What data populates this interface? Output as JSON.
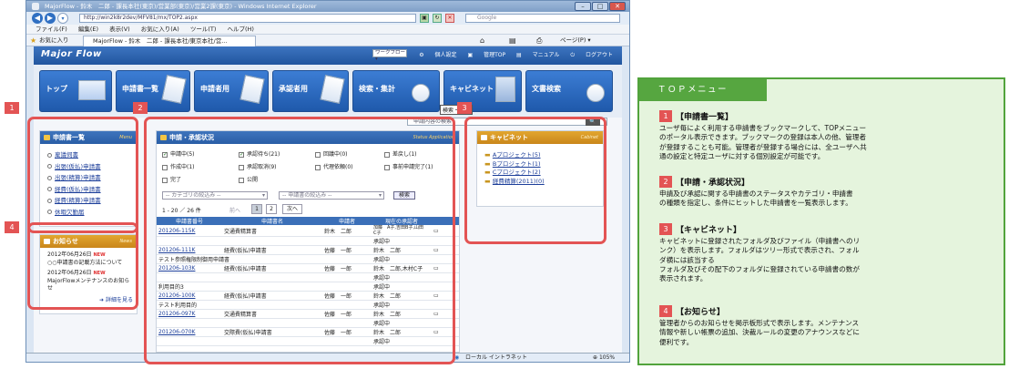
{
  "ie": {
    "title": "MajorFlow - 鈴木　二郎 - 課長本社(東京)/営業部(東京)/営業2課(東京) - Windows Internet Explorer",
    "address": "http://win2k8r2dev/MFV81/mx/TOP2.aspx",
    "search_placeholder": "Google",
    "menu": [
      "ファイル(F)",
      "編集(E)",
      "表示(V)",
      "お気に入り(A)",
      "ツール(T)",
      "ヘルプ(H)"
    ],
    "favorites_label": "お気に入り",
    "tab_label": "MajorFlow - 鈴木　二郎 - 課長本社/東京本社/営...",
    "page_label": "ページ(P) ▾",
    "status_zone": "ローカル イントラネット",
    "zoom": "105%"
  },
  "app": {
    "logo": "Major Flow",
    "header_links": [
      "個人設定",
      "管理TOP",
      "マニュアル",
      "ログアウト"
    ],
    "header_select": "ワークフロー",
    "nav": [
      "トップ",
      "申請書一覧",
      "申請者用",
      "承認者用",
      "検索・集計",
      "キャビネット",
      "文書検索"
    ],
    "tooltip": "検索・集計",
    "search_placeholder": "申請内容の検索"
  },
  "panels": {
    "list": {
      "title": "申請書一覧",
      "sub": "Menu",
      "items": [
        "稟議伺書",
        "出張(仮払)申請書",
        "出張(精算)申請書",
        "経費(仮払)申請書",
        "経費(精算)申請書",
        "休暇欠勤届"
      ]
    },
    "notice": {
      "title": "お知らせ",
      "sub": "News",
      "items": [
        {
          "date": "2012年06月26日",
          "badge": "NEW",
          "text": "○○申請書の記載方法について"
        },
        {
          "date": "2012年06月26日",
          "badge": "NEW",
          "text": "MajorFlowメンテナンスのお知らせ"
        }
      ],
      "more": "詳細を見る"
    },
    "status": {
      "title": "申請・承認状況",
      "sub": "Status Application",
      "filters": [
        {
          "label": "申請中(5)",
          "checked": true
        },
        {
          "label": "承認待ち(21)",
          "checked": true
        },
        {
          "label": "回議中(0)",
          "checked": false
        },
        {
          "label": "差戻し(1)",
          "checked": false
        },
        {
          "label": "作成中(1)",
          "checked": false
        },
        {
          "label": "承認取消(9)",
          "checked": false
        },
        {
          "label": "代理依頼(0)",
          "checked": false
        },
        {
          "label": "事前申請完了(1)",
          "checked": false
        },
        {
          "label": "完了",
          "checked": false
        },
        {
          "label": "公開",
          "checked": false
        }
      ],
      "category_select": "-- カテゴリの絞込み --",
      "form_select": "-- 申請書の絞込み --",
      "search_button": "検索",
      "paging": "1 - 20 ／ 26 件",
      "prev": "前へ",
      "pages": [
        "1",
        "2"
      ],
      "next": "次へ",
      "columns": [
        "申請書番号",
        "申請書名",
        "申請者",
        "現在の承認者"
      ],
      "rows": [
        {
          "id": "201206-115K",
          "name": "交通費精算書",
          "applicant": "鈴木　二郎",
          "approver": "加藤　A子,吉田B子,山田　C子",
          "status": "承認中"
        },
        {
          "id": "201206-111K",
          "name": "経費(仮払)申請書",
          "applicant": "佐藤　一郎",
          "approver": "鈴木　二郎",
          "status": "承認中"
        },
        {
          "id": "",
          "name": "テスト参照権限制御用申請書",
          "applicant": "",
          "approver": "",
          "status": ""
        },
        {
          "id": "201206-103K",
          "name": "経費(仮払)申請書",
          "applicant": "佐藤　一郎",
          "approver": "鈴木　二郎,木村C子",
          "status": "承認中"
        },
        {
          "id": "",
          "name": "利用目的3",
          "applicant": "",
          "approver": "",
          "status": "承認中"
        },
        {
          "id": "201206-100K",
          "name": "経費(仮払)申請書",
          "applicant": "佐藤　一郎",
          "approver": "鈴木　二郎",
          "status": "承認中"
        },
        {
          "id": "",
          "name": "テスト利用目的",
          "applicant": "",
          "approver": "",
          "status": ""
        },
        {
          "id": "201206-097K",
          "name": "交通費精算書",
          "applicant": "佐藤　一郎",
          "approver": "鈴木　二郎",
          "status": "承認中"
        },
        {
          "id": "201206-070K",
          "name": "交際費(仮払)申請書",
          "applicant": "佐藤　一郎",
          "approver": "鈴木　二郎",
          "status": "承認中"
        }
      ]
    },
    "cabinet": {
      "title": "キャビネット",
      "sub": "Cabinet",
      "items": [
        "Aプロジェクト(5)",
        "Bプロジェクト(1)",
        "Cプロジェクト(2)",
        "経費精算(2011)(0)"
      ]
    }
  },
  "markers": [
    "1",
    "2",
    "3",
    "4"
  ],
  "top_menu": {
    "title": "ＴＯＰメニュー",
    "sections": [
      {
        "num": "1",
        "title": "【申請書一覧】",
        "body": "ユーザ毎によく利用する申請書をブックマークして、TOPメニュー\nのポータル表示できます。ブックマークの登録は本人の他、管理者\nが登録することも可能。管理者が登録する場合には、全ユーザへ共\n通の設定と特定ユーザに対する個別設定が可能です。"
      },
      {
        "num": "2",
        "title": "【申請・承認状況】",
        "body": "申請及び承認に関する申請書のステータスやカテゴリ・申請書\nの種類を指定し、条件にヒットした申請書を一覧表示します。"
      },
      {
        "num": "3",
        "title": "【キャビネット】",
        "body": "キャビネットに登録されたフォルダ及びファイル（申請書へのリ\nンク）を表示します。フォルダはツリー形式で表示され、フォル\nダ横には該当する\nフォルダ及びその配下のフォルダに登録されている申請書の数が\n表示されます。"
      },
      {
        "num": "4",
        "title": "【お知らせ】",
        "body": "管理者からのお知らせを掲示板形式で表示します。メンテナンス\n情報や新しい帳票の追加、決裁ルールの変更のアナウンスなどに\n便利です。"
      }
    ]
  }
}
